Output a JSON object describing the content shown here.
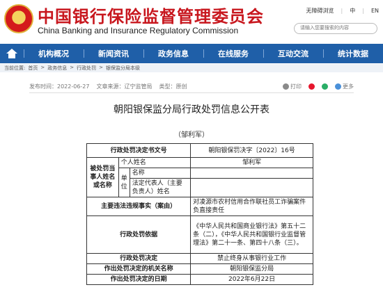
{
  "header": {
    "title_cn": "中国银行保险监督管理委员会",
    "title_en": "China Banking and Insurance Regulatory Commission",
    "top_links": [
      "无障碍浏览",
      "中",
      "EN"
    ],
    "search_placeholder": "请输入您要搜索的内容"
  },
  "nav": {
    "items": [
      "机构概况",
      "新闻资讯",
      "政务信息",
      "在线服务",
      "互动交流",
      "统计数据"
    ]
  },
  "breadcrumb": {
    "prefix": "当前位置:",
    "items": [
      "首页",
      ">",
      "政务信息",
      ">",
      "行政处罚",
      ">",
      "银保监分局本级"
    ]
  },
  "meta": {
    "date": "发布时间：2022-06-27",
    "source": "文章来源：辽宁监管局",
    "type": "类型：原创",
    "print": "打印",
    "weibo": "",
    "wechat": "",
    "more": "更多"
  },
  "doc": {
    "title": "朝阳银保监分局行政处罚信息公开表",
    "subtitle": "（邹利军）"
  },
  "table": {
    "decision_no_label": "行政处罚决定书文号",
    "decision_no": "朝阳银保罚决字〔2022〕16号",
    "party_label": "被处罚当事人姓名或名称",
    "individual_label": "个人姓名",
    "individual_name": "邹利军",
    "unit_label": "单位",
    "unit_name_label": "名称",
    "unit_name": "",
    "legal_rep_label": "法定代表人（主要负责人）姓名",
    "legal_rep": "",
    "violation_label": "主要违法违规事实（案由）",
    "violation": "对凌源市农村信用合作联社员工诈骗案件负直接责任",
    "basis_label": "行政处罚依据",
    "basis": "《中华人民共和国商业银行法》第五十二条（二），《中华人民共和国银行业监督管理法》第二十一条、第四十八条（三）。",
    "decision_label": "行政处罚决定",
    "decision": "禁止终身从事银行业工作",
    "authority_label": "作出处罚决定的机关名称",
    "authority": "朝阳银保监分局",
    "date_label": "作出处罚决定的日期",
    "date": "2022年6月22日"
  },
  "colors": {
    "brand_red": "#c8171e",
    "nav_blue": "#1f5fa8"
  }
}
